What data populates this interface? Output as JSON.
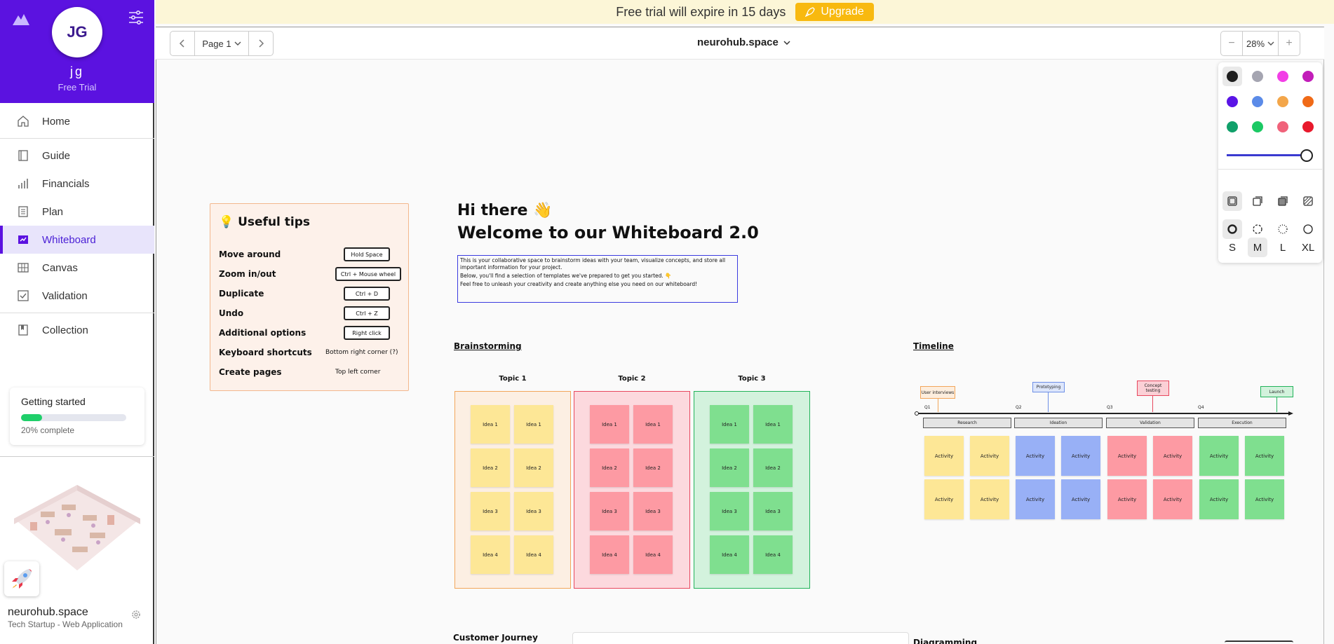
{
  "sidebar": {
    "user": {
      "initials": "JG",
      "name": "jg",
      "plan": "Free Trial"
    },
    "nav": [
      {
        "label": "Home",
        "icon": "home-icon"
      },
      {
        "label": "Guide",
        "icon": "book-icon"
      },
      {
        "label": "Financials",
        "icon": "bar-chart-icon"
      },
      {
        "label": "Plan",
        "icon": "document-icon"
      },
      {
        "label": "Whiteboard",
        "icon": "whiteboard-icon",
        "active": true
      },
      {
        "label": "Canvas",
        "icon": "grid-icon"
      },
      {
        "label": "Validation",
        "icon": "checklist-icon"
      },
      {
        "label": "Collection",
        "icon": "bookmark-icon"
      }
    ],
    "getting_started": {
      "title": "Getting started",
      "progress": 0.2,
      "label": "20% complete"
    },
    "project": {
      "name": "neurohub.space",
      "subtitle": "Tech Startup - Web Application"
    }
  },
  "banner": {
    "text": "Free trial will expire in 15 days",
    "upgrade": "Upgrade"
  },
  "toolbar": {
    "page": "Page 1",
    "workspace": "neurohub.space",
    "zoom": "28%",
    "zoom_out": "−",
    "zoom_in": "+"
  },
  "style_panel": {
    "colors": [
      "#1e1e1e",
      "#a5a5b1",
      "#f23ee6",
      "#c21db9",
      "#5a14e6",
      "#5b8be8",
      "#f3a64a",
      "#f06a17",
      "#10a06a",
      "#1bc964",
      "#f0627a",
      "#e8192c"
    ],
    "selected_color": "#1e1e1e",
    "sizes": [
      "S",
      "M",
      "L",
      "XL"
    ],
    "selected_size": "M"
  },
  "tips": {
    "title": "Useful tips",
    "rows": [
      {
        "label": "Move around",
        "key": "Hold Space",
        "boxed": true
      },
      {
        "label": "Zoom in/out",
        "key": "Ctrl + Mouse wheel",
        "boxed": true
      },
      {
        "label": "Duplicate",
        "key": "Ctrl + D",
        "boxed": true
      },
      {
        "label": "Undo",
        "key": "Ctrl + Z",
        "boxed": true
      },
      {
        "label": "Additional options",
        "key": "Right click",
        "boxed": true
      },
      {
        "label": "Keyboard shortcuts",
        "key": "Bottom right corner (?)",
        "boxed": false
      },
      {
        "label": "Create pages",
        "key": "Top left corner",
        "boxed": false
      }
    ]
  },
  "welcome": {
    "hi": "Hi there 👋",
    "title": "Welcome to our Whiteboard 2.0",
    "paragraphs": [
      "This is your collaborative space to brainstorm ideas with your team, visualize concepts, and store all important information for your project.",
      "Below, you'll find a selection of templates we've prepared to get you started. 👇",
      "Feel free to unleash your creativity and create anything else you need on our whiteboard!"
    ]
  },
  "brainstorming": {
    "title": "Brainstorming",
    "topics": [
      {
        "name": "Topic 1",
        "bg": "#fcefe3",
        "border": "#f2a65a",
        "note": "#fde796"
      },
      {
        "name": "Topic 2",
        "bg": "#fcd9de",
        "border": "#e8485f",
        "note": "#fd9aa3"
      },
      {
        "name": "Topic 3",
        "bg": "#d3f2dd",
        "border": "#22b35a",
        "note": "#7fdf8f"
      }
    ],
    "ideas": [
      "Idea 1",
      "Idea 1",
      "Idea 2",
      "Idea 2",
      "Idea 3",
      "Idea 3",
      "Idea 4",
      "Idea 4"
    ]
  },
  "timeline": {
    "title": "Timeline",
    "quarters": [
      "Q1",
      "Q2",
      "Q3",
      "Q4"
    ],
    "phases": [
      "Research",
      "Ideation",
      "Validation",
      "Execution"
    ],
    "milestones": [
      {
        "label": "User interviews",
        "bg": "#fdeede",
        "border": "#f2a65a"
      },
      {
        "label": "Prototyping",
        "bg": "#dde6fb",
        "border": "#6d8fe6"
      },
      {
        "label": "Concept testing",
        "bg": "#fbd0d6",
        "border": "#e8485f"
      },
      {
        "label": "Launch",
        "bg": "#d2f2dc",
        "border": "#22b35a"
      }
    ],
    "activity_label": "Activity",
    "activity_colors": [
      "#fde796",
      "#fde796",
      "#98b0f6",
      "#98b0f6",
      "#fd9aa3",
      "#fd9aa3",
      "#7fdf8f",
      "#7fdf8f"
    ]
  },
  "bottom": {
    "customer_journey": "Customer Journey",
    "diagramming": "Diagramming"
  }
}
